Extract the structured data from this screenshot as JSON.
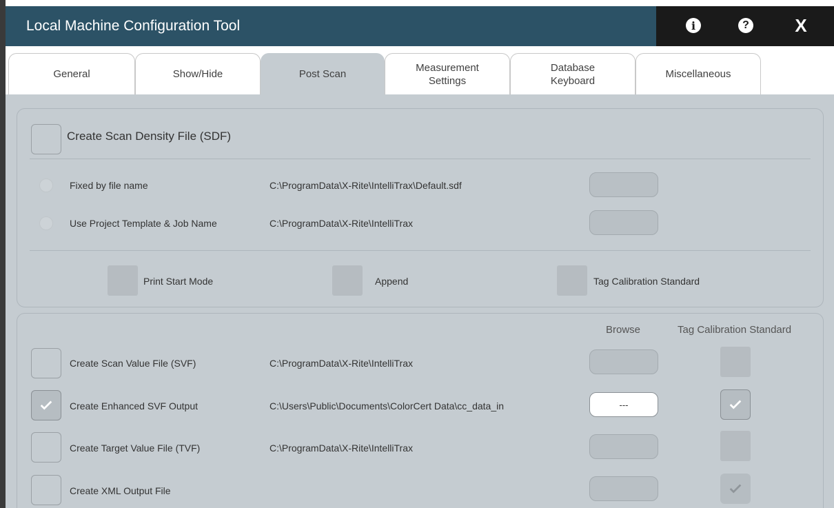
{
  "window": {
    "title": "Local Machine Configuration Tool",
    "info_icon": "info-icon",
    "help_icon": "help-icon",
    "close_label": "X"
  },
  "tabs": [
    {
      "label": "General",
      "active": false
    },
    {
      "label": "Show/Hide",
      "active": false
    },
    {
      "label": "Post Scan",
      "active": true
    },
    {
      "label": "Measurement\nSettings",
      "active": false
    },
    {
      "label": "Database\nKeyboard",
      "active": false
    },
    {
      "label": "Miscellaneous",
      "active": false
    }
  ],
  "sdf": {
    "label": "Create Scan Density File (SDF)",
    "checked": false,
    "options": [
      {
        "label": "Fixed by file name",
        "path": "C:\\ProgramData\\X-Rite\\IntelliTrax\\Default.sdf"
      },
      {
        "label": "Use Project Template & Job Name",
        "path": "C:\\ProgramData\\X-Rite\\IntelliTrax"
      }
    ],
    "flags": [
      {
        "label": "Print Start Mode"
      },
      {
        "label": "Append"
      },
      {
        "label": "Tag Calibration Standard"
      }
    ]
  },
  "outputs": {
    "browse_header": "Browse",
    "tag_header": "Tag Calibration Standard",
    "rows": [
      {
        "label": "Create Scan Value File (SVF)",
        "path": "C:\\ProgramData\\X-Rite\\IntelliTrax",
        "checked": false,
        "browse": "",
        "tag": "none"
      },
      {
        "label": "Create Enhanced SVF Output",
        "path": "C:\\Users\\Public\\Documents\\ColorCert Data\\cc_data_in",
        "checked": true,
        "browse": "---",
        "tag": "checked"
      },
      {
        "label": "Create Target Value File (TVF)",
        "path": "C:\\ProgramData\\X-Rite\\IntelliTrax",
        "checked": false,
        "browse": "",
        "tag": "none"
      },
      {
        "label": "Create XML Output File",
        "path": "",
        "checked": false,
        "browse": "",
        "tag": "checked-disabled"
      }
    ]
  }
}
